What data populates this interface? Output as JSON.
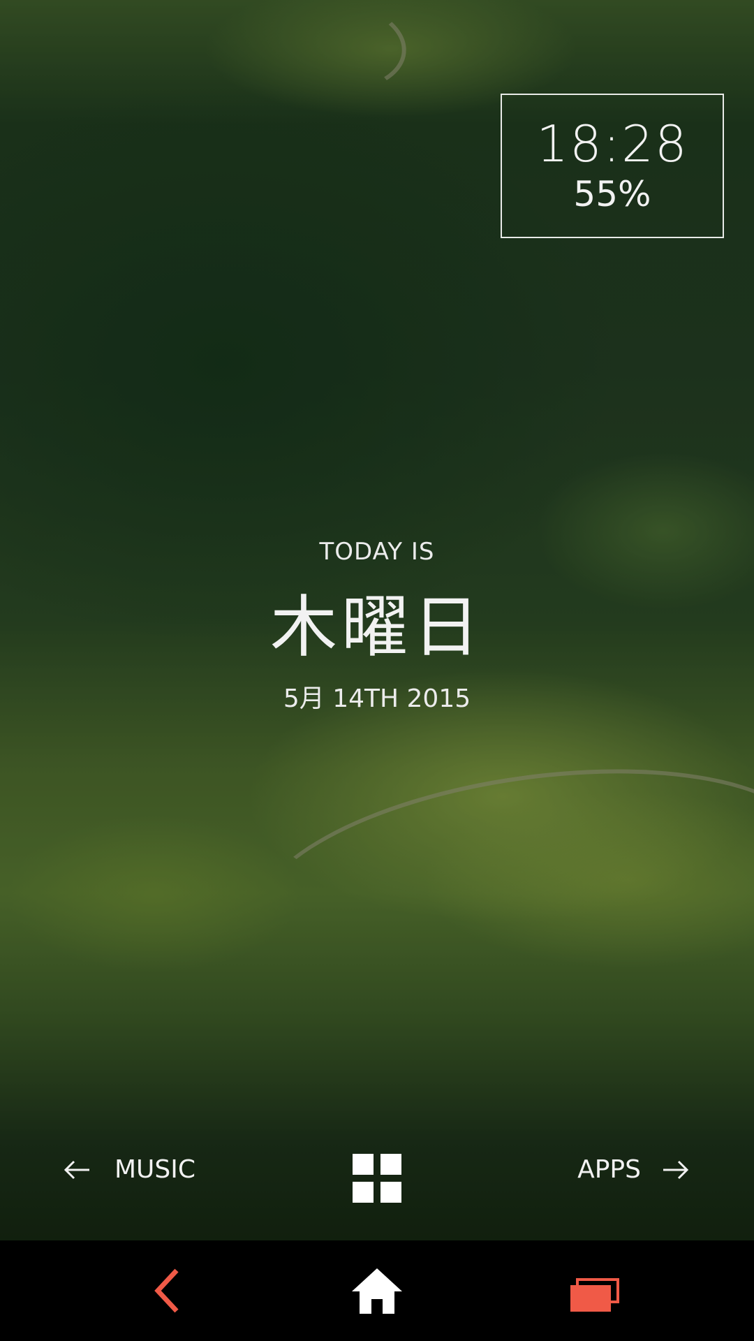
{
  "clock": {
    "time": "18:28",
    "battery": "55%"
  },
  "day": {
    "label": "TODAY IS",
    "name": "木曜日",
    "date": "5月 14TH 2015"
  },
  "shortcuts": {
    "left_label": "MUSIC",
    "left_icon": "arrow-left-icon",
    "center_icon": "app-grid-icon",
    "right_label": "APPS",
    "right_icon": "arrow-right-icon"
  },
  "navbar": {
    "back_icon": "back-chevron-icon",
    "home_icon": "home-icon",
    "recents_icon": "recents-icon",
    "accent_color": "#f05a47",
    "home_color": "#ffffff"
  }
}
